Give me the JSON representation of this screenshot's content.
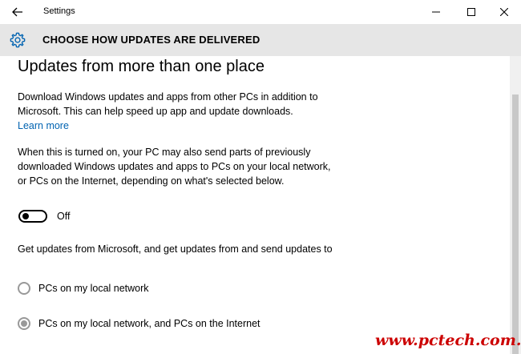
{
  "window": {
    "title": "Settings",
    "back_icon": "back-arrow-icon",
    "minimize_icon": "minimize-icon",
    "maximize_icon": "maximize-icon",
    "close_icon": "close-icon"
  },
  "header": {
    "icon": "gear-icon",
    "title": "CHOOSE HOW UPDATES ARE DELIVERED"
  },
  "content": {
    "section_title": "Updates from more than one place",
    "paragraph1": "Download Windows updates and apps from other PCs in addition to Microsoft. This can help speed up app and update downloads.",
    "learn_more": "Learn more",
    "paragraph2": "When this is turned on, your PC may also send parts of previously downloaded Windows updates and apps to PCs on your local network, or PCs on the Internet, depending on what's selected below.",
    "toggle": {
      "state_label": "Off",
      "on": false
    },
    "paragraph3": "Get updates from Microsoft, and get updates from and send updates to",
    "radio_options": [
      {
        "label": "PCs on my local network",
        "checked": false
      },
      {
        "label": "PCs on my local network, and PCs on the Internet",
        "checked": true
      }
    ]
  },
  "watermark": "www.pctech.com.vn",
  "colors": {
    "header_bg": "#e6e6e6",
    "link": "#0063b1",
    "watermark": "#cc0000",
    "radio_disabled": "#999999"
  }
}
